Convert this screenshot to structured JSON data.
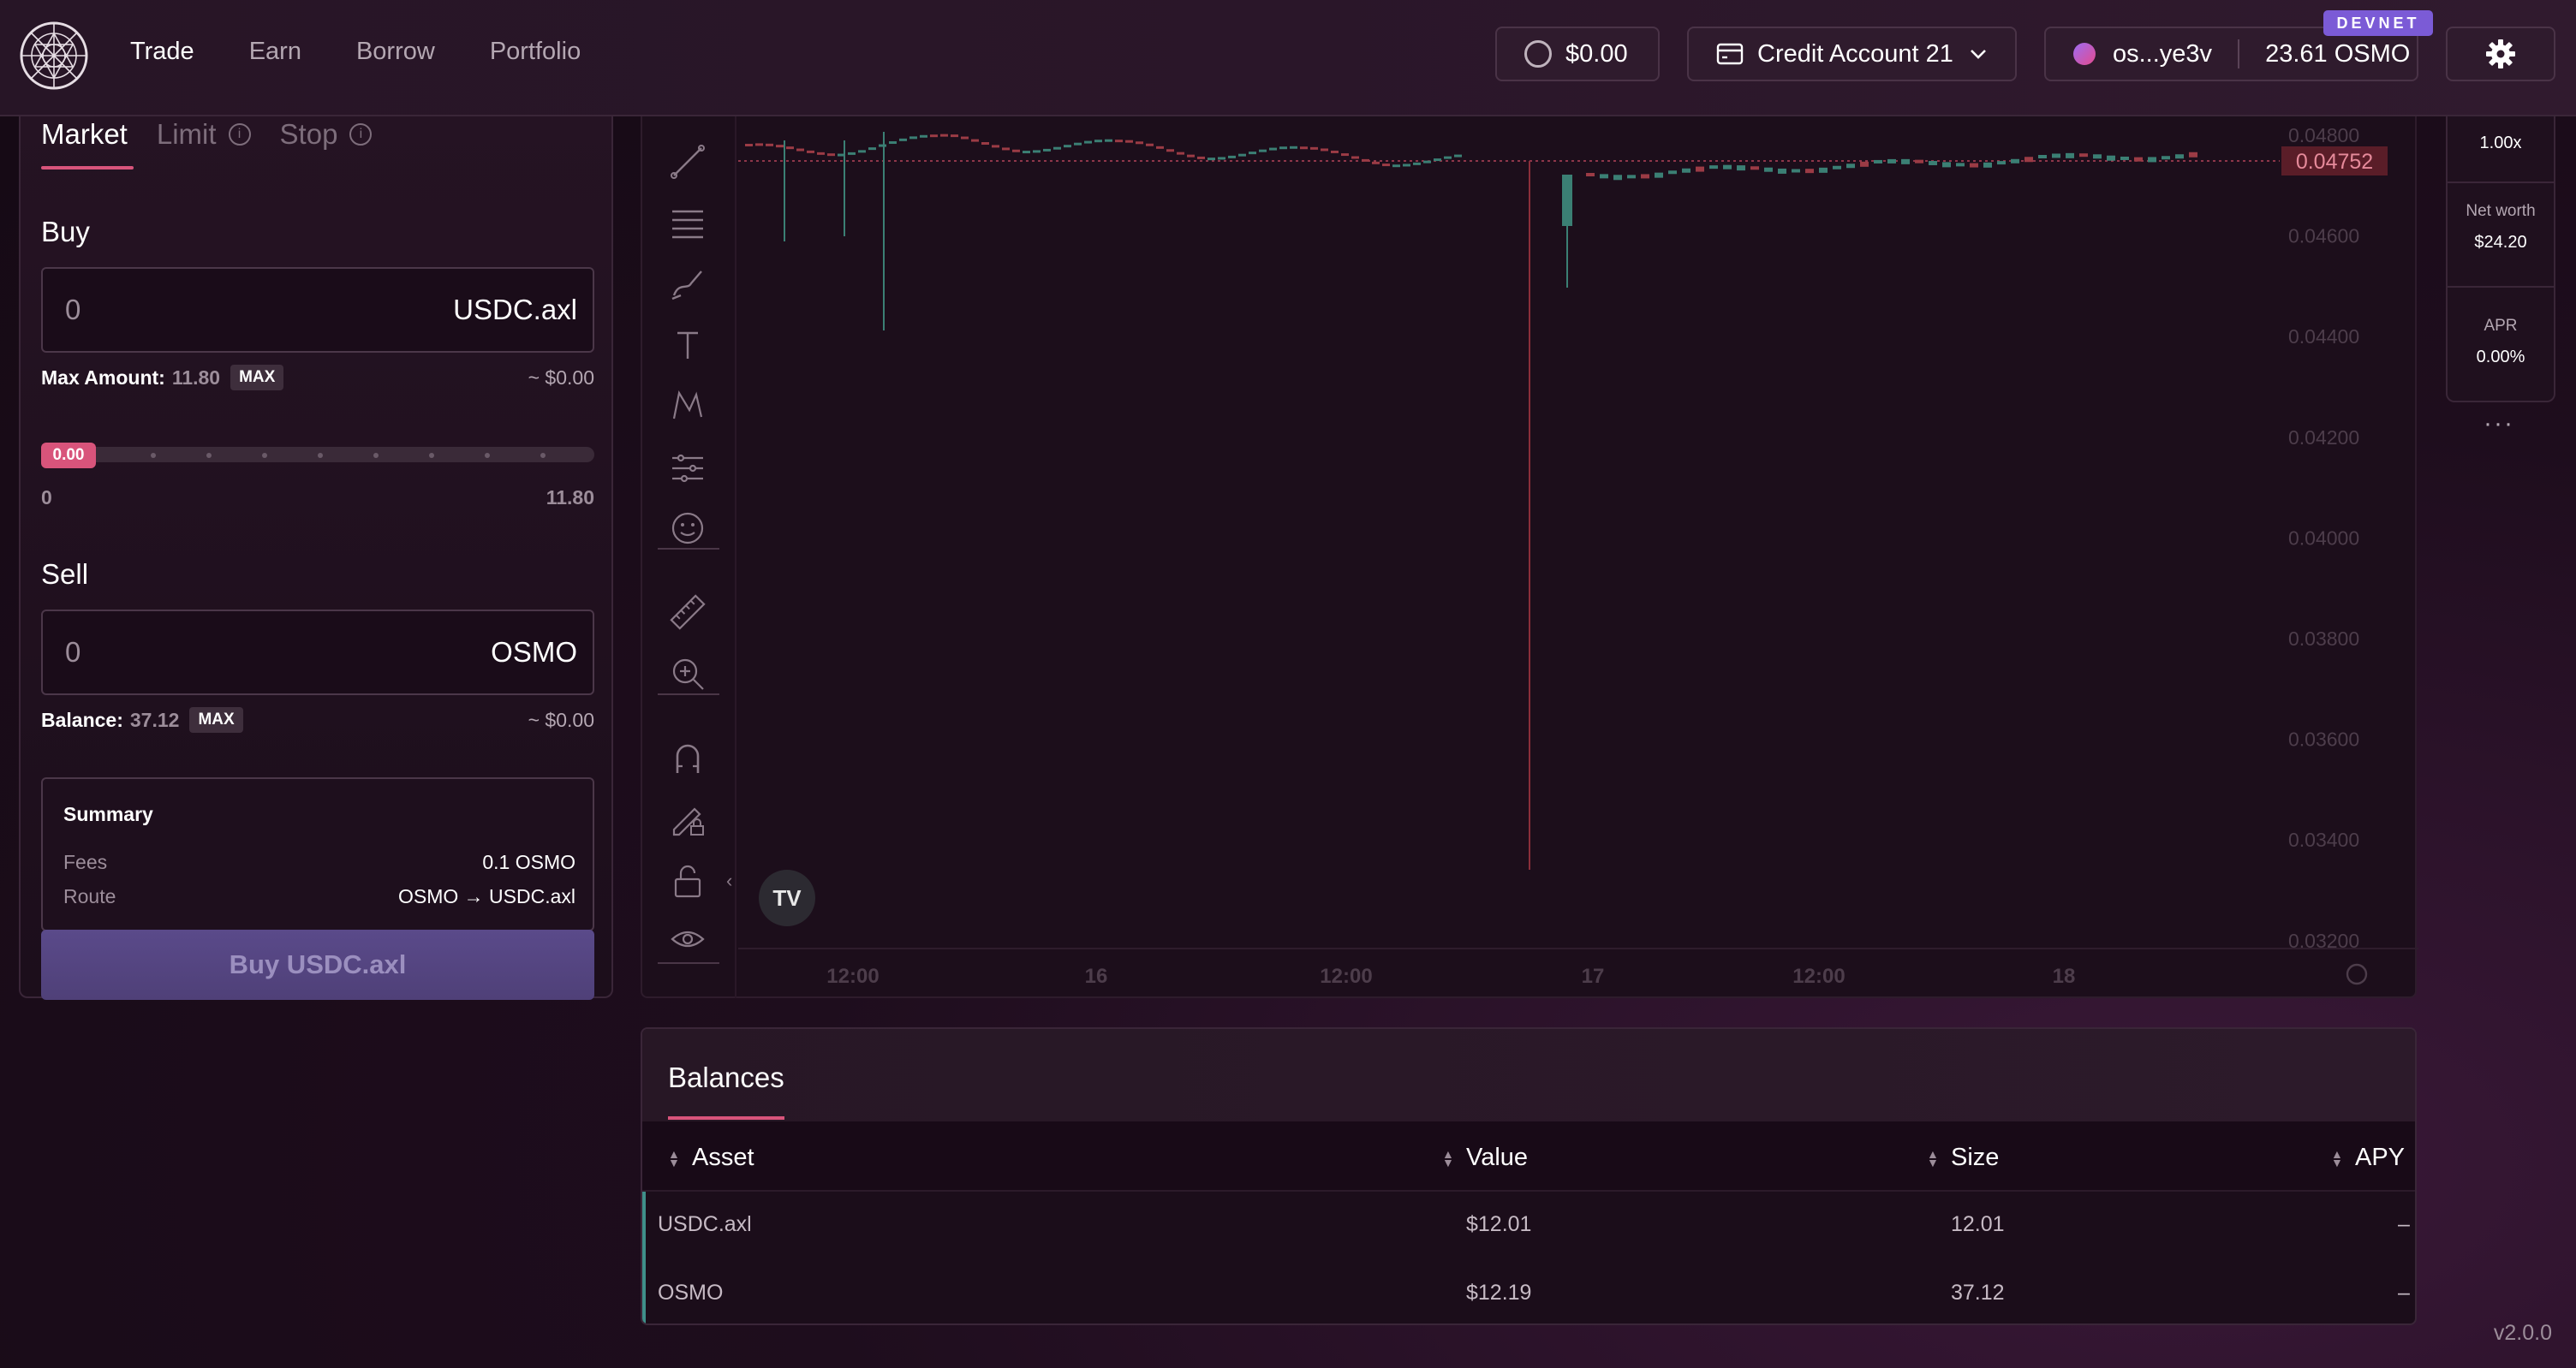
{
  "header": {
    "nav": [
      {
        "label": "Trade",
        "active": true
      },
      {
        "label": "Earn",
        "active": false
      },
      {
        "label": "Borrow",
        "active": false
      },
      {
        "label": "Portfolio",
        "active": false
      }
    ],
    "balance_label": "$0.00",
    "account_label": "Credit Account 21",
    "wallet_address": "os...ye3v",
    "wallet_balance": "23.61 OSMO",
    "network_badge": "DEVNET",
    "icons": [
      "logo-icon",
      "coin-icon",
      "card-icon",
      "chevron-down-icon",
      "osmo-token-icon",
      "gear-icon"
    ]
  },
  "trade": {
    "tabs": [
      {
        "label": "Market",
        "active": true,
        "info": false
      },
      {
        "label": "Limit",
        "active": false,
        "info": true
      },
      {
        "label": "Stop",
        "active": false,
        "info": true
      }
    ],
    "buy": {
      "label": "Buy",
      "value": "0",
      "token": "USDC.axl",
      "max_label": "Max Amount:",
      "max_value": "11.80",
      "max_btn": "MAX",
      "usd": "~ $0.00"
    },
    "slider": {
      "value_label": "0.00",
      "min": "0",
      "max": "11.80",
      "fraction": 0
    },
    "sell": {
      "label": "Sell",
      "value": "0",
      "token": "OSMO",
      "balance_label": "Balance:",
      "balance_value": "37.12",
      "max_btn": "MAX",
      "usd": "~ $0.00"
    },
    "summary": {
      "title": "Summary",
      "fees_label": "Fees",
      "fees_value": "0.1 OSMO",
      "route_label": "Route",
      "route_value": "OSMO → USDC.axl"
    },
    "submit_label": "Buy USDC.axl"
  },
  "chart": {
    "price_tag": "0.04752",
    "y_ticks": [
      "0.04800",
      "0.04600",
      "0.04400",
      "0.04200",
      "0.04000",
      "0.03800",
      "0.03600",
      "0.03400",
      "0.03200"
    ],
    "x_ticks": [
      "12:00",
      "16",
      "12:00",
      "17",
      "12:00",
      "18"
    ],
    "tv_logo": "TV",
    "colors": {
      "up": "#3b7f74",
      "down": "#9b3b45",
      "price_line": "#b4445a"
    }
  },
  "stats": {
    "leverage": "1.00x",
    "net_worth_label": "Net worth",
    "net_worth_value": "$24.20",
    "apr_label": "APR",
    "apr_value": "0.00%",
    "more": "···"
  },
  "balances": {
    "title": "Balances",
    "columns": [
      "Asset",
      "Value",
      "Size",
      "APY"
    ],
    "rows": [
      {
        "asset": "USDC.axl",
        "value": "$12.01",
        "size": "12.01",
        "apy": "–"
      },
      {
        "asset": "OSMO",
        "value": "$12.19",
        "size": "37.12",
        "apy": "–"
      }
    ]
  },
  "version": "v2.0.0"
}
